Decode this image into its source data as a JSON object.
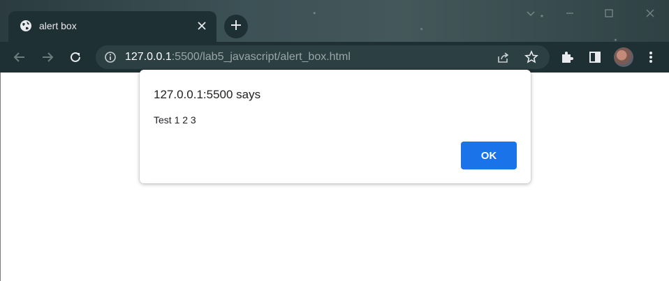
{
  "tab": {
    "title": "alert box",
    "favicon": "globe-icon"
  },
  "toolbar": {
    "url_host": "127.0.0.1",
    "url_rest": ":5500/lab5_javascript/alert_box.html"
  },
  "dialog": {
    "title": "127.0.0.1:5500 says",
    "message": "Test 1 2 3",
    "ok_label": "OK"
  },
  "colors": {
    "accent": "#1a73e8",
    "chrome_dark": "#1e3034",
    "omnibox": "#2c3f43"
  },
  "icons": [
    "globe-icon",
    "close-icon",
    "plus-icon",
    "back-arrow-icon",
    "forward-arrow-icon",
    "reload-icon",
    "info-icon",
    "share-icon",
    "star-icon",
    "extensions-puzzle-icon",
    "side-panel-icon",
    "avatar",
    "kebab-menu-icon"
  ]
}
